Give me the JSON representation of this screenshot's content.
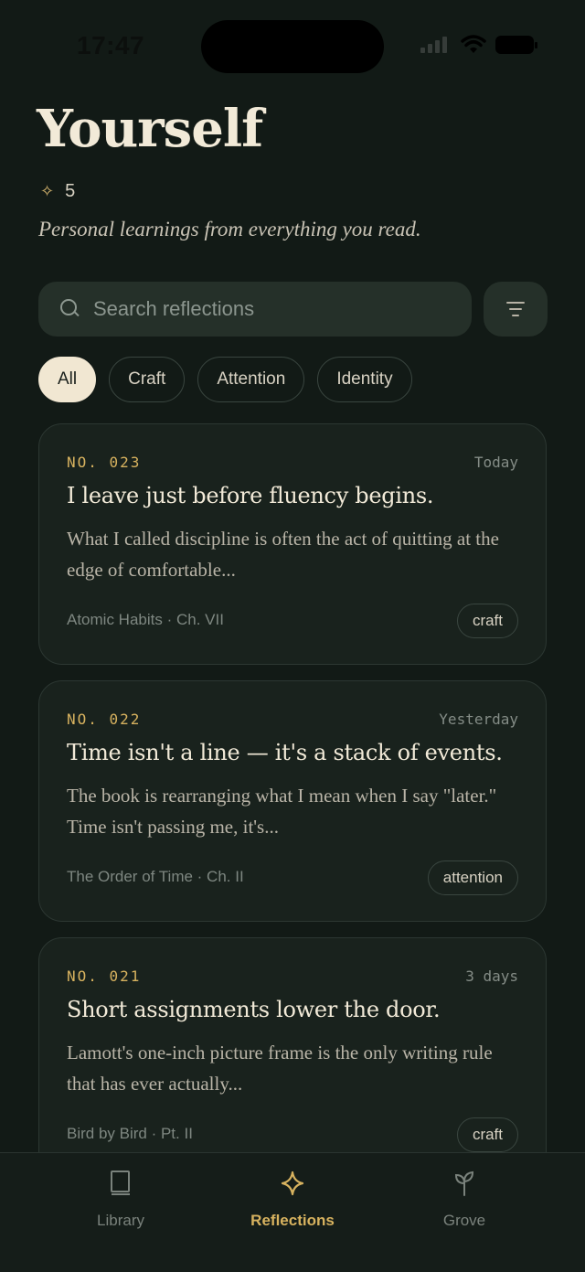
{
  "status": {
    "time": "17:47"
  },
  "header": {
    "title": "Yourself",
    "count": "5",
    "subtitle": "Personal learnings from everything you read."
  },
  "search": {
    "placeholder": "Search reflections"
  },
  "filters": {
    "chips": [
      {
        "label": "All",
        "active": true
      },
      {
        "label": "Craft",
        "active": false
      },
      {
        "label": "Attention",
        "active": false
      },
      {
        "label": "Identity",
        "active": false
      }
    ]
  },
  "reflections": [
    {
      "number": "NO. 023",
      "date": "Today",
      "title": "I leave just before fluency begins.",
      "excerpt": "What I called discipline is often the act of quitting at the edge of comfortable...",
      "source": "Atomic Habits · Ch. VII",
      "tag": "craft"
    },
    {
      "number": "NO. 022",
      "date": "Yesterday",
      "title": "Time isn't a line — it's a stack of events.",
      "excerpt": "The book is rearranging what I mean when I say \"later.\" Time isn't passing me, it's...",
      "source": "The Order of Time · Ch. II",
      "tag": "attention"
    },
    {
      "number": "NO. 021",
      "date": "3 days",
      "title": "Short assignments lower the door.",
      "excerpt": "Lamott's one-inch picture frame is the only writing rule that has ever actually...",
      "source": "Bird by Bird · Pt. II",
      "tag": "craft"
    }
  ],
  "tabbar": {
    "tabs": [
      {
        "label": "Library",
        "icon": "book-icon",
        "active": false
      },
      {
        "label": "Reflections",
        "icon": "sparkle-icon",
        "active": true
      },
      {
        "label": "Grove",
        "icon": "sprout-icon",
        "active": false
      }
    ]
  },
  "colors": {
    "background": "#121a16",
    "accent": "#d7b25f",
    "card": "#19221d",
    "active_chip": "#f1e7d2"
  }
}
